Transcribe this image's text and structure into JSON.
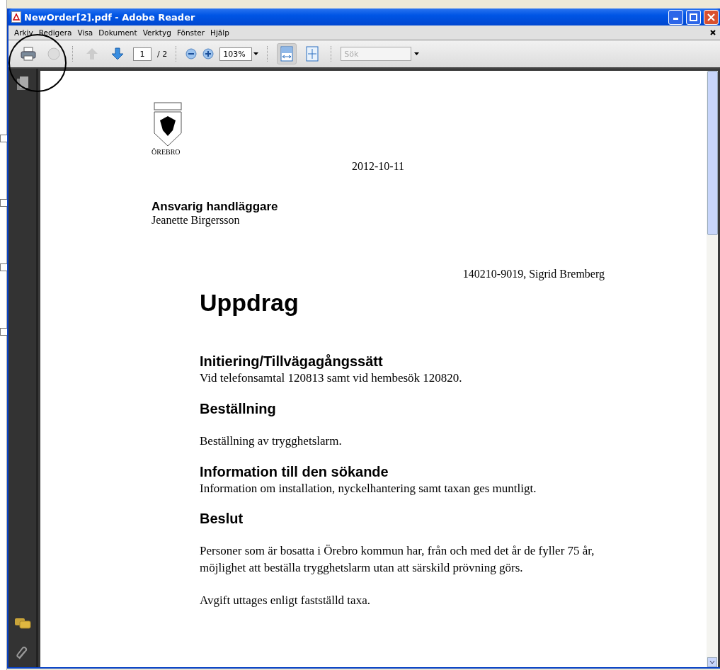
{
  "window": {
    "title": "NewOrder[2].pdf - Adobe Reader"
  },
  "menu": [
    "Arkiv",
    "Redigera",
    "Visa",
    "Dokument",
    "Verktyg",
    "Fönster",
    "Hjälp"
  ],
  "toolbar": {
    "page_number": "1",
    "page_total": "/ 2",
    "zoom": "103%",
    "search": {
      "placeholder": "Sök"
    },
    "fit_width_selected": true
  },
  "document": {
    "logo_text": "ÖREBRO",
    "date": "2012-10-11",
    "handler_label": "Ansvarig handläggare",
    "handler_name": "Jeanette Birgersson",
    "client": "140210-9019, Sigrid Bremberg",
    "title": "Uppdrag",
    "sections": [
      {
        "heading": "Initiering/Tillvägagångssätt",
        "paragraphs": [
          "Vid telefonsamtal 120813 samt vid hembesök 120820."
        ]
      },
      {
        "heading": "Beställning",
        "paragraphs": [
          "Beställning av trygghetslarm."
        ]
      },
      {
        "heading": "Information till den sökande",
        "paragraphs": [
          "Information om installation, nyckelhantering samt taxan ges muntligt."
        ]
      },
      {
        "heading": "Beslut",
        "paragraphs": [
          "Personer som är bosatta i Örebro kommun har, från och med det år de fyller 75 år, möjlighet att beställa trygghetslarm utan att särskild prövning görs.",
          "Avgift uttages enligt fastställd taxa."
        ]
      }
    ]
  }
}
